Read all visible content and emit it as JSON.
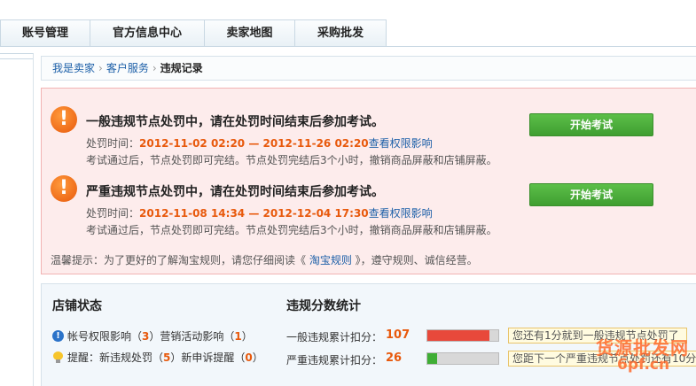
{
  "nav": {
    "tabs": [
      "账号管理",
      "官方信息中心",
      "卖家地图",
      "采购批发"
    ]
  },
  "breadcrumb": {
    "items": [
      "我是卖家",
      "客户服务"
    ],
    "current": "违规记录",
    "separator": "›"
  },
  "alerts": [
    {
      "title": "一般违规节点处罚中，请在处罚时间结束后参加考试。",
      "time_label": "处罚时间：",
      "time_range": "2012-11-02 02:20 — 2012-11-26 02:20",
      "link": "查看权限影响",
      "note": "考试通过后，节点处罚即可完结。节点处罚完结后3个小时，撤销商品屏蔽和店铺屏蔽。",
      "button": "开始考试"
    },
    {
      "title": "严重违规节点处罚中，请在处罚时间结束后参加考试。",
      "time_label": "处罚时间：",
      "time_range": "2012-11-08 14:34 — 2012-12-04 17:30",
      "link": "查看权限影响",
      "note": "考试通过后，节点处罚即可完结。节点处罚完结后3个小时，撤销商品屏蔽和店铺屏蔽。",
      "button": "开始考试"
    }
  ],
  "tip": {
    "prefix": "温馨提示：为了更好的了解淘宝规则，请您仔细阅读《",
    "link": " 淘宝规则 ",
    "suffix": "》，遵守规则、诚信经营。"
  },
  "shop_status": {
    "title": "店铺状态",
    "line1": {
      "a": "帐号权限影响（",
      "a_num": "3",
      "b": "）营销活动影响（",
      "b_num": "1",
      "c": "）"
    },
    "line2": {
      "a": "提醒：新违规处罚（",
      "a_num": "5",
      "b": "）新申诉提醒（",
      "b_num": "0",
      "c": "）"
    }
  },
  "score_stats": {
    "title": "违规分数统计",
    "rows": [
      {
        "label": "一般违规累计扣分：",
        "value": "107",
        "fill_fraction": 0.88,
        "fill_color": "#e8493b",
        "callout": "您还有1分就到一般违规节点处罚了"
      },
      {
        "label": "严重违规累计扣分：",
        "value": "26",
        "fill_fraction": 0.14,
        "fill_color": "#3fae35",
        "callout": "您距下一个严重违规节点处罚还有10分"
      }
    ]
  },
  "watermark": {
    "line1": "货源批发网",
    "line2": "6pf.cn"
  },
  "colors": {
    "accent_orange": "#e8590c",
    "link_blue": "#1c5fa8",
    "button_green": "#4caf3c",
    "alert_bg": "#fdecec"
  }
}
